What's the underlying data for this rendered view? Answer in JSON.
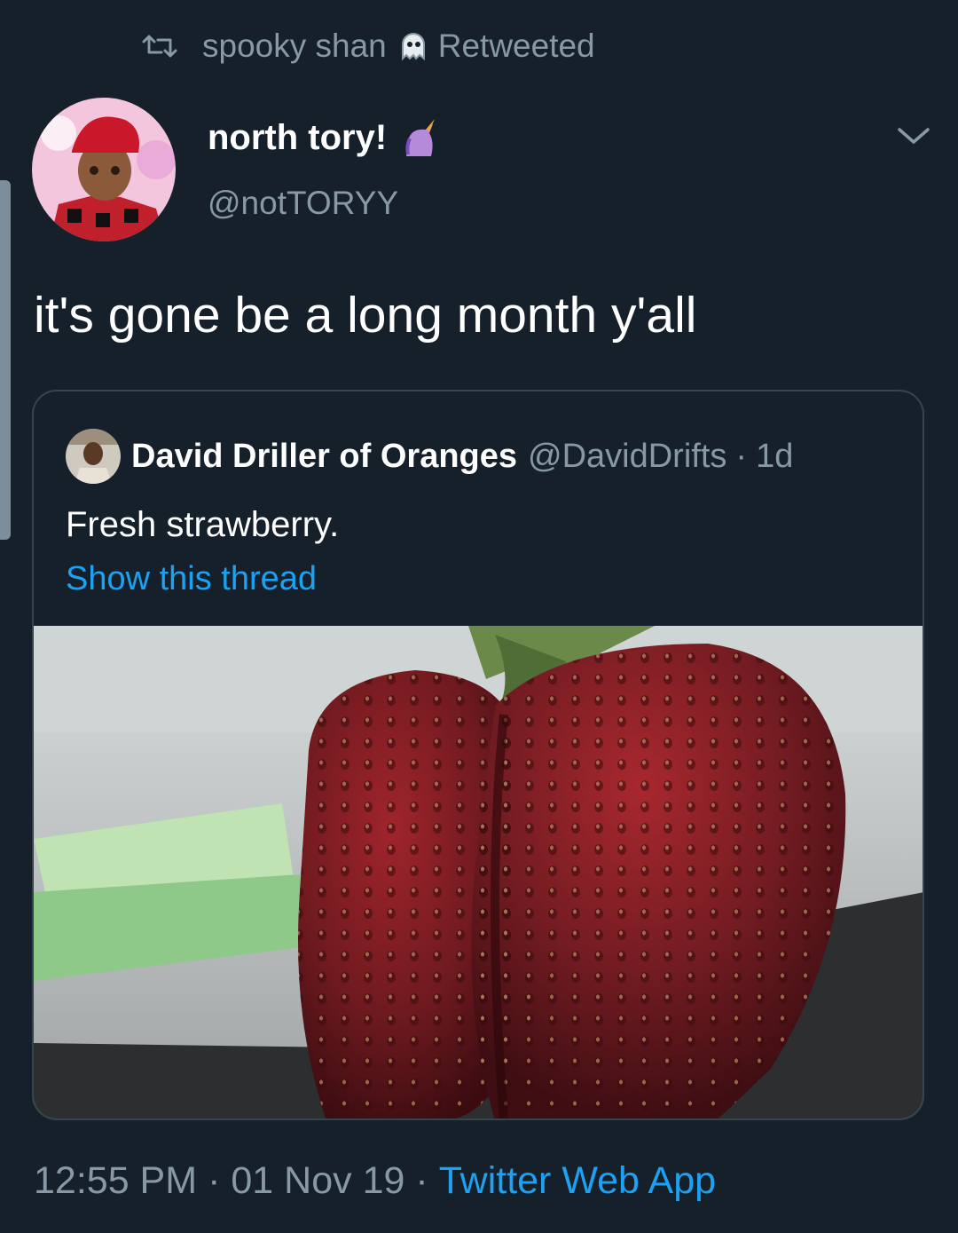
{
  "retweet": {
    "icon": "retweet-icon",
    "user": "spooky shan",
    "emoji": "ghost-icon",
    "label": "Retweeted"
  },
  "tweet": {
    "display_name": "north tory!",
    "name_emoji": "unicorn-icon",
    "handle": "@notTORYY",
    "text": "it's gone be a long month y'all"
  },
  "quote": {
    "display_name": "David Driller of Oranges",
    "handle": "@DavidDrifts",
    "dot": "·",
    "time": "1d",
    "text": "Fresh strawberry.",
    "show_thread": "Show this thread"
  },
  "footer": {
    "time": "12:55 PM",
    "date": "01 Nov 19",
    "source": "Twitter Web App",
    "sep": "·"
  },
  "colors": {
    "background": "#15202b",
    "secondary_text": "#8899a6",
    "link": "#1da1f2",
    "border": "#38444d"
  }
}
